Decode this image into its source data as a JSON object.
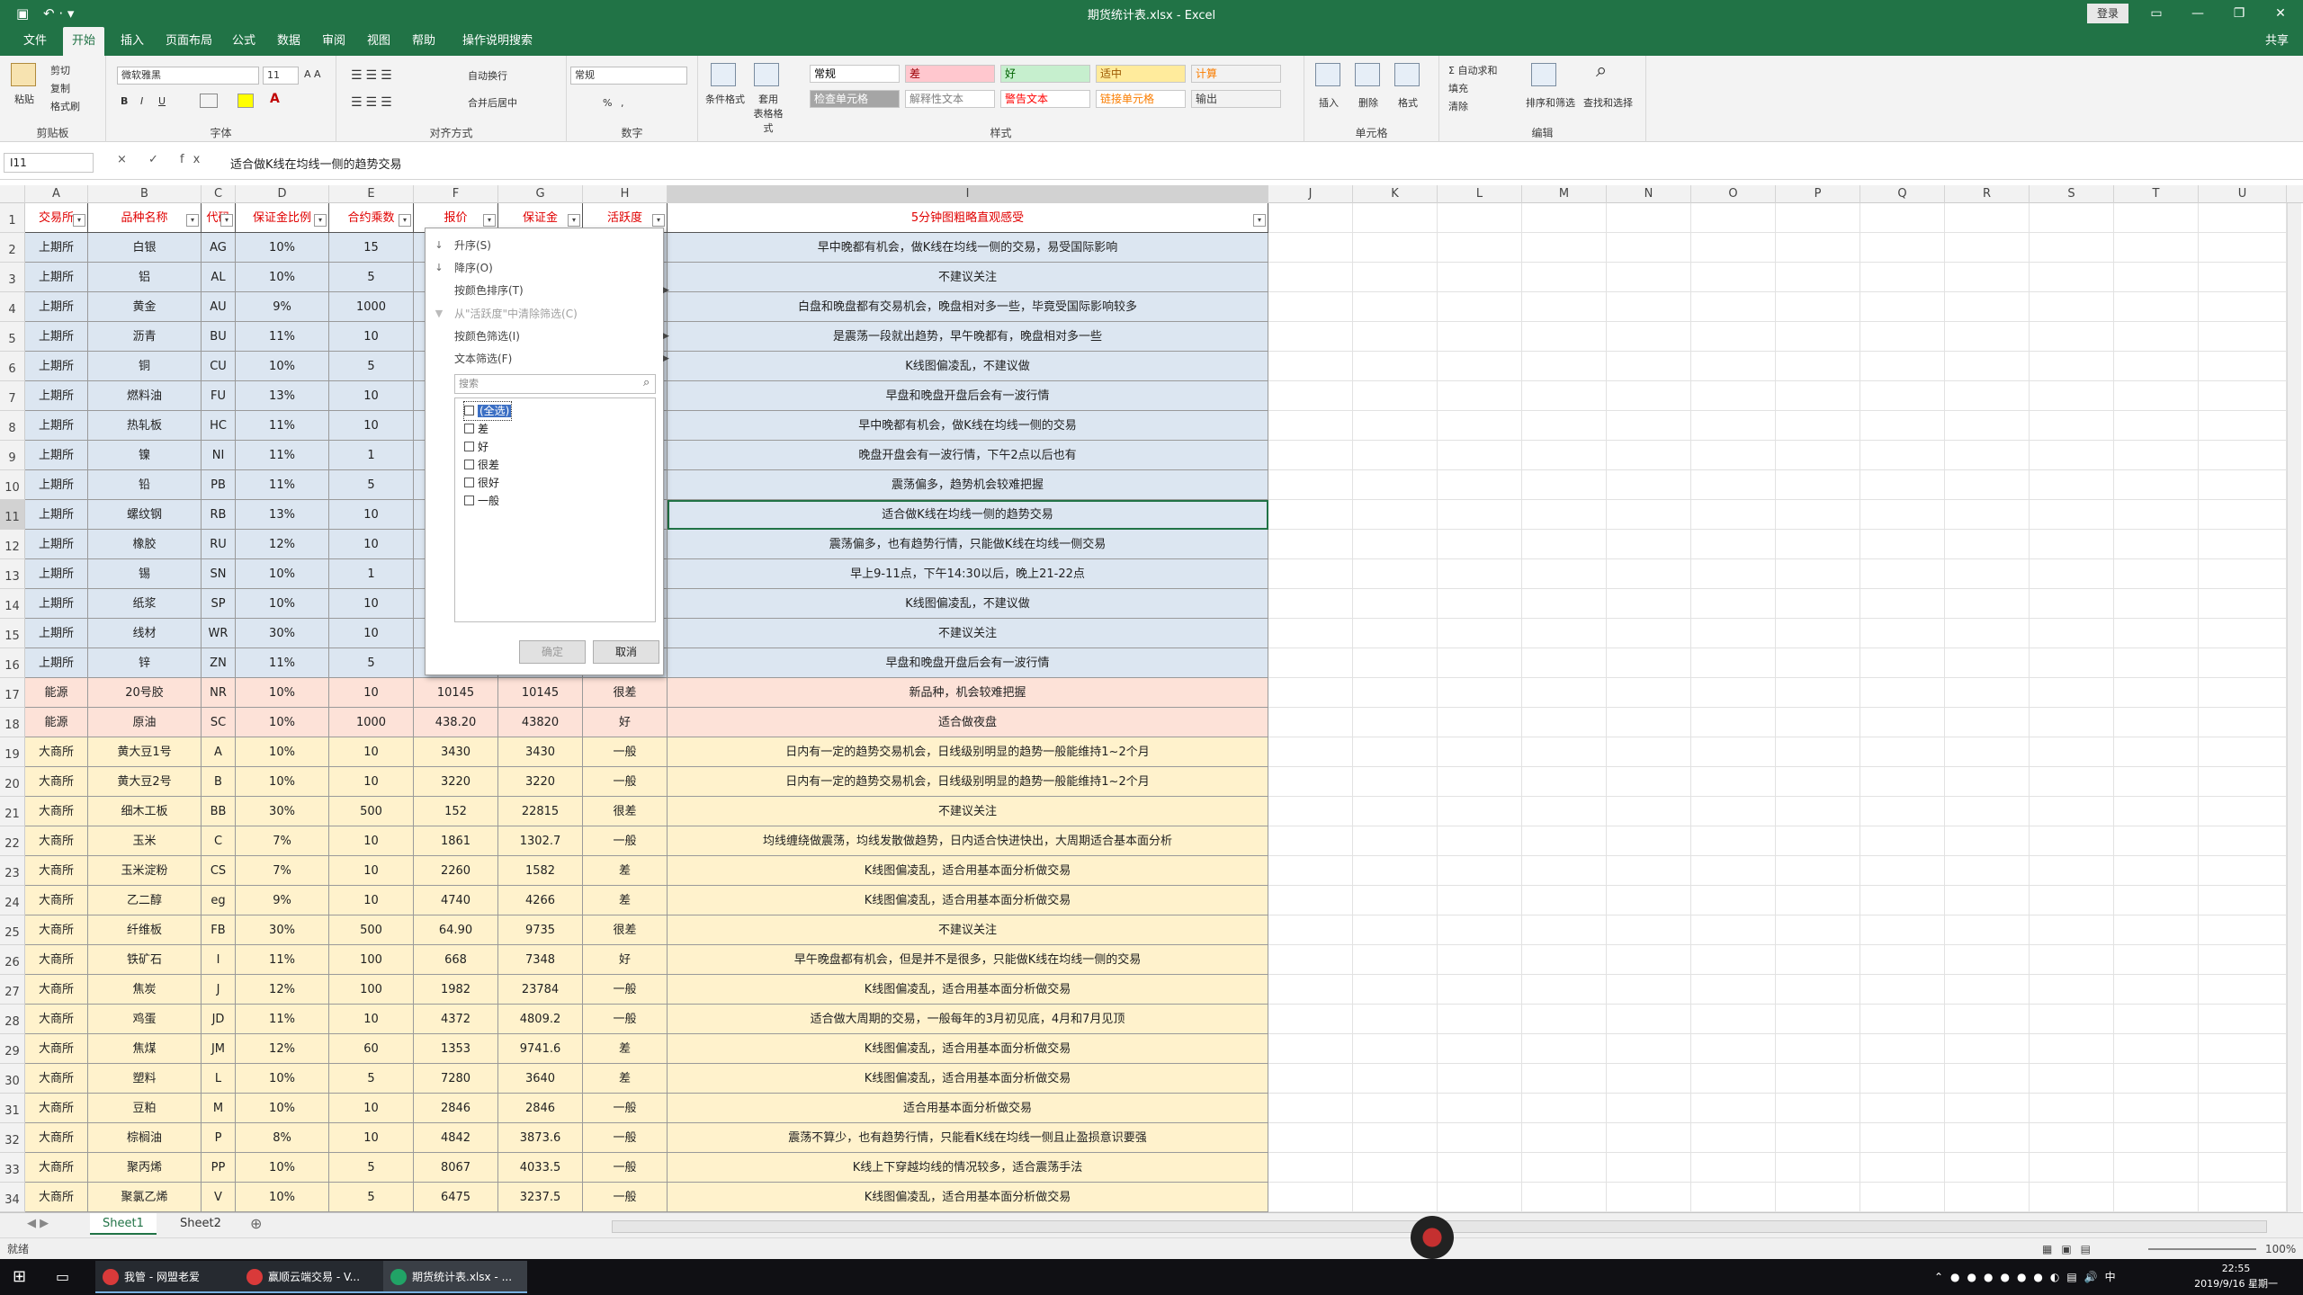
{
  "app": {
    "title": "期货统计表.xlsx - Excel",
    "login": "登录",
    "share": "共享",
    "qat": "↶ · ▾"
  },
  "tabs": [
    "文件",
    "开始",
    "插入",
    "页面布局",
    "公式",
    "数据",
    "审阅",
    "视图",
    "帮助",
    "操作说明搜索"
  ],
  "ribbon": {
    "clipboard": {
      "paste": "粘贴",
      "cut": "剪切",
      "copy": "复制",
      "painter": "格式刷",
      "label": "剪贴板"
    },
    "font": {
      "name": "微软雅黑",
      "size": "11",
      "label": "字体",
      "bold": "B",
      "italic": "I",
      "underline": "U"
    },
    "align": {
      "wrap": "自动换行",
      "merge": "合并后居中",
      "label": "对齐方式"
    },
    "number": {
      "format": "常规",
      "label": "数字",
      "pct": "%",
      "comma": ","
    },
    "styles": {
      "cond": "条件格式",
      "table": "套用\n表格格式",
      "label": "样式",
      "cells": [
        {
          "text": "常规",
          "bg": "#ffffff",
          "fg": "#000000"
        },
        {
          "text": "差",
          "bg": "#ffc7ce",
          "fg": "#9c0006"
        },
        {
          "text": "好",
          "bg": "#c6efce",
          "fg": "#006100"
        },
        {
          "text": "适中",
          "bg": "#ffeb9c",
          "fg": "#9c5700"
        },
        {
          "text": "计算",
          "bg": "#f2f2f2",
          "fg": "#fa7d00"
        },
        {
          "text": "检查单元格",
          "bg": "#a5a5a5",
          "fg": "#ffffff"
        },
        {
          "text": "解释性文本",
          "bg": "#ffffff",
          "fg": "#7f7f7f"
        },
        {
          "text": "警告文本",
          "bg": "#ffffff",
          "fg": "#ff0000"
        },
        {
          "text": "链接单元格",
          "bg": "#ffffff",
          "fg": "#fa7d00"
        },
        {
          "text": "输出",
          "bg": "#f2f2f2",
          "fg": "#3f3f3f"
        }
      ]
    },
    "cellsgrp": {
      "insert": "插入",
      "delete": "删除",
      "format": "格式",
      "label": "单元格"
    },
    "edit": {
      "autosum": "自动求和",
      "fill": "填充",
      "clear": "清除",
      "sort": "排序和筛选",
      "find": "查找和选择",
      "label": "编辑"
    }
  },
  "formula": {
    "namebox": "I11",
    "fx": "× ✓ fx",
    "content": "适合做K线在均线一侧的趋势交易"
  },
  "columns": [
    "A",
    "B",
    "C",
    "D",
    "E",
    "F",
    "G",
    "H",
    "I",
    "J",
    "K",
    "L",
    "M",
    "N",
    "O",
    "P",
    "Q",
    "R",
    "S",
    "T",
    "U"
  ],
  "header": [
    "交易所",
    "品种名称",
    "代码",
    "保证金比例",
    "合约乘数",
    "报价",
    "保证金",
    "活跃度",
    "5分钟图粗略直观感受"
  ],
  "rows": [
    {
      "r": "2",
      "a": "上期所",
      "b": "白银",
      "c": "AG",
      "d": "10%",
      "e": "15",
      "f": "",
      "g": "",
      "h": "",
      "i": "早中晚都有机会，做K线在均线一侧的交易，易受国际影响",
      "bg": "#dce6f1"
    },
    {
      "r": "3",
      "a": "上期所",
      "b": "铝",
      "c": "AL",
      "d": "10%",
      "e": "5",
      "f": "",
      "g": "",
      "h": "",
      "i": "不建议关注",
      "bg": "#dce6f1"
    },
    {
      "r": "4",
      "a": "上期所",
      "b": "黄金",
      "c": "AU",
      "d": "9%",
      "e": "1000",
      "f": "",
      "g": "",
      "h": "",
      "i": "白盘和晚盘都有交易机会，晚盘相对多一些，毕竟受国际影响较多",
      "bg": "#dce6f1"
    },
    {
      "r": "5",
      "a": "上期所",
      "b": "沥青",
      "c": "BU",
      "d": "11%",
      "e": "10",
      "f": "",
      "g": "",
      "h": "",
      "i": "是震荡一段就出趋势，早午晚都有，晚盘相对多一些",
      "bg": "#dce6f1"
    },
    {
      "r": "6",
      "a": "上期所",
      "b": "铜",
      "c": "CU",
      "d": "10%",
      "e": "5",
      "f": "",
      "g": "",
      "h": "",
      "i": "K线图偏凌乱，不建议做",
      "bg": "#dce6f1"
    },
    {
      "r": "7",
      "a": "上期所",
      "b": "燃料油",
      "c": "FU",
      "d": "13%",
      "e": "10",
      "f": "",
      "g": "",
      "h": "",
      "i": "早盘和晚盘开盘后会有一波行情",
      "bg": "#dce6f1"
    },
    {
      "r": "8",
      "a": "上期所",
      "b": "热轧板",
      "c": "HC",
      "d": "11%",
      "e": "10",
      "f": "",
      "g": "",
      "h": "",
      "i": "早中晚都有机会，做K线在均线一侧的交易",
      "bg": "#dce6f1"
    },
    {
      "r": "9",
      "a": "上期所",
      "b": "镍",
      "c": "NI",
      "d": "11%",
      "e": "1",
      "f": "",
      "g": "",
      "h": "",
      "i": "晚盘开盘会有一波行情，下午2点以后也有",
      "bg": "#dce6f1"
    },
    {
      "r": "10",
      "a": "上期所",
      "b": "铅",
      "c": "PB",
      "d": "11%",
      "e": "5",
      "f": "",
      "g": "",
      "h": "",
      "i": "震荡偏多，趋势机会较难把握",
      "bg": "#dce6f1"
    },
    {
      "r": "11",
      "a": "上期所",
      "b": "螺纹钢",
      "c": "RB",
      "d": "13%",
      "e": "10",
      "f": "",
      "g": "",
      "h": "",
      "i": "适合做K线在均线一侧的趋势交易",
      "bg": "#dce6f1"
    },
    {
      "r": "12",
      "a": "上期所",
      "b": "橡胶",
      "c": "RU",
      "d": "12%",
      "e": "10",
      "f": "",
      "g": "",
      "h": "",
      "i": "震荡偏多，也有趋势行情，只能做K线在均线一侧交易",
      "bg": "#dce6f1"
    },
    {
      "r": "13",
      "a": "上期所",
      "b": "锡",
      "c": "SN",
      "d": "10%",
      "e": "1",
      "f": "",
      "g": "",
      "h": "",
      "i": "早上9-11点，下午14:30以后，晚上21-22点",
      "bg": "#dce6f1"
    },
    {
      "r": "14",
      "a": "上期所",
      "b": "纸浆",
      "c": "SP",
      "d": "10%",
      "e": "10",
      "f": "",
      "g": "",
      "h": "",
      "i": "K线图偏凌乱，不建议做",
      "bg": "#dce6f1"
    },
    {
      "r": "15",
      "a": "上期所",
      "b": "线材",
      "c": "WR",
      "d": "30%",
      "e": "10",
      "f": "",
      "g": "",
      "h": "",
      "i": "不建议关注",
      "bg": "#dce6f1"
    },
    {
      "r": "16",
      "a": "上期所",
      "b": "锌",
      "c": "ZN",
      "d": "11%",
      "e": "5",
      "f": "",
      "g": "",
      "h": "",
      "i": "早盘和晚盘开盘后会有一波行情",
      "bg": "#dce6f1"
    },
    {
      "r": "17",
      "a": "能源",
      "b": "20号胶",
      "c": "NR",
      "d": "10%",
      "e": "10",
      "f": "10145",
      "g": "10145",
      "h": "很差",
      "i": "新品种，机会较难把握",
      "bg": "#fde2d8"
    },
    {
      "r": "18",
      "a": "能源",
      "b": "原油",
      "c": "SC",
      "d": "10%",
      "e": "1000",
      "f": "438.20",
      "g": "43820",
      "h": "好",
      "i": "适合做夜盘",
      "bg": "#fde2d8"
    },
    {
      "r": "19",
      "a": "大商所",
      "b": "黄大豆1号",
      "c": "A",
      "d": "10%",
      "e": "10",
      "f": "3430",
      "g": "3430",
      "h": "一般",
      "i": "日内有一定的趋势交易机会，日线级别明显的趋势一般能维持1~2个月",
      "bg": "#fff2cc"
    },
    {
      "r": "20",
      "a": "大商所",
      "b": "黄大豆2号",
      "c": "B",
      "d": "10%",
      "e": "10",
      "f": "3220",
      "g": "3220",
      "h": "一般",
      "i": "日内有一定的趋势交易机会，日线级别明显的趋势一般能维持1~2个月",
      "bg": "#fff2cc"
    },
    {
      "r": "21",
      "a": "大商所",
      "b": "细木工板",
      "c": "BB",
      "d": "30%",
      "e": "500",
      "f": "152",
      "g": "22815",
      "h": "很差",
      "i": "不建议关注",
      "bg": "#fff2cc"
    },
    {
      "r": "22",
      "a": "大商所",
      "b": "玉米",
      "c": "C",
      "d": "7%",
      "e": "10",
      "f": "1861",
      "g": "1302.7",
      "h": "一般",
      "i": "均线缠绕做震荡，均线发散做趋势，日内适合快进快出，大周期适合基本面分析",
      "bg": "#fff2cc"
    },
    {
      "r": "23",
      "a": "大商所",
      "b": "玉米淀粉",
      "c": "CS",
      "d": "7%",
      "e": "10",
      "f": "2260",
      "g": "1582",
      "h": "差",
      "i": "K线图偏凌乱，适合用基本面分析做交易",
      "bg": "#fff2cc"
    },
    {
      "r": "24",
      "a": "大商所",
      "b": "乙二醇",
      "c": "eg",
      "d": "9%",
      "e": "10",
      "f": "4740",
      "g": "4266",
      "h": "差",
      "i": "K线图偏凌乱，适合用基本面分析做交易",
      "bg": "#fff2cc"
    },
    {
      "r": "25",
      "a": "大商所",
      "b": "纤维板",
      "c": "FB",
      "d": "30%",
      "e": "500",
      "f": "64.90",
      "g": "9735",
      "h": "很差",
      "i": "不建议关注",
      "bg": "#fff2cc"
    },
    {
      "r": "26",
      "a": "大商所",
      "b": "铁矿石",
      "c": "I",
      "d": "11%",
      "e": "100",
      "f": "668",
      "g": "7348",
      "h": "好",
      "i": "早午晚盘都有机会，但是并不是很多，只能做K线在均线一侧的交易",
      "bg": "#fff2cc"
    },
    {
      "r": "27",
      "a": "大商所",
      "b": "焦炭",
      "c": "J",
      "d": "12%",
      "e": "100",
      "f": "1982",
      "g": "23784",
      "h": "一般",
      "i": "K线图偏凌乱，适合用基本面分析做交易",
      "bg": "#fff2cc"
    },
    {
      "r": "28",
      "a": "大商所",
      "b": "鸡蛋",
      "c": "JD",
      "d": "11%",
      "e": "10",
      "f": "4372",
      "g": "4809.2",
      "h": "一般",
      "i": "适合做大周期的交易，一般每年的3月初见底，4月和7月见顶",
      "bg": "#fff2cc"
    },
    {
      "r": "29",
      "a": "大商所",
      "b": "焦煤",
      "c": "JM",
      "d": "12%",
      "e": "60",
      "f": "1353",
      "g": "9741.6",
      "h": "差",
      "i": "K线图偏凌乱，适合用基本面分析做交易",
      "bg": "#fff2cc"
    },
    {
      "r": "30",
      "a": "大商所",
      "b": "塑料",
      "c": "L",
      "d": "10%",
      "e": "5",
      "f": "7280",
      "g": "3640",
      "h": "差",
      "i": "K线图偏凌乱，适合用基本面分析做交易",
      "bg": "#fff2cc"
    },
    {
      "r": "31",
      "a": "大商所",
      "b": "豆粕",
      "c": "M",
      "d": "10%",
      "e": "10",
      "f": "2846",
      "g": "2846",
      "h": "一般",
      "i": "适合用基本面分析做交易",
      "bg": "#fff2cc"
    },
    {
      "r": "32",
      "a": "大商所",
      "b": "棕榈油",
      "c": "P",
      "d": "8%",
      "e": "10",
      "f": "4842",
      "g": "3873.6",
      "h": "一般",
      "i": "震荡不算少，也有趋势行情，只能看K线在均线一侧且止盈损意识要强",
      "bg": "#fff2cc"
    },
    {
      "r": "33",
      "a": "大商所",
      "b": "聚丙烯",
      "c": "PP",
      "d": "10%",
      "e": "5",
      "f": "8067",
      "g": "4033.5",
      "h": "一般",
      "i": "K线上下穿越均线的情况较多，适合震荡手法",
      "bg": "#fff2cc"
    },
    {
      "r": "34",
      "a": "大商所",
      "b": "聚氯乙烯",
      "c": "V",
      "d": "10%",
      "e": "5",
      "f": "6475",
      "g": "3237.5",
      "h": "一般",
      "i": "K线图偏凌乱，适合用基本面分析做交易",
      "bg": "#fff2cc"
    }
  ],
  "filter": {
    "sort_asc": "升序(S)",
    "sort_desc": "降序(O)",
    "sort_color": "按颜色排序(T)",
    "clear": "从\"活跃度\"中清除筛选(C)",
    "filter_color": "按颜色筛选(I)",
    "text_filter": "文本筛选(F)",
    "search": "搜索",
    "options": [
      {
        "label": "(全选)",
        "checked": false
      },
      {
        "label": "差",
        "checked": false
      },
      {
        "label": "好",
        "checked": false
      },
      {
        "label": "很差",
        "checked": false
      },
      {
        "label": "很好",
        "checked": false
      },
      {
        "label": "一般",
        "checked": false
      }
    ],
    "ok": "确定",
    "cancel": "取消"
  },
  "sheets": [
    "Sheet1",
    "Sheet2"
  ],
  "status": {
    "ready": "就绪",
    "zoom": "100%"
  },
  "taskbar": {
    "items": [
      "我管 - 网盟老爱",
      "赢顺云端交易 - V...",
      "期货统计表.xlsx - ..."
    ],
    "time": "22:55",
    "date": "2019/9/16 星期一"
  }
}
